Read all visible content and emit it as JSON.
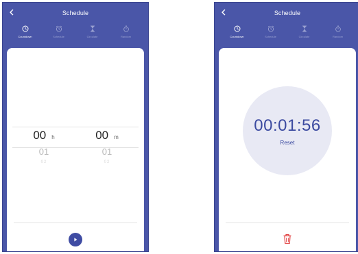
{
  "screens": [
    {
      "header": {
        "title": "Schedule"
      },
      "tabs": [
        {
          "label": "Countdown",
          "icon": "clock-icon",
          "active": true
        },
        {
          "label": "Schedule",
          "icon": "alarm-icon",
          "active": false
        },
        {
          "label": "Circulate",
          "icon": "hourglass-icon",
          "active": false
        },
        {
          "label": "Random",
          "icon": "stopwatch-icon",
          "active": false
        }
      ],
      "picker": {
        "hours": {
          "selected": "00",
          "unit": "h",
          "next": "01",
          "next2": "02"
        },
        "minutes": {
          "selected": "00",
          "unit": "m",
          "next": "01",
          "next2": "02"
        }
      }
    },
    {
      "header": {
        "title": "Schedule"
      },
      "tabs": [
        {
          "label": "Countdown",
          "icon": "clock-icon",
          "active": true
        },
        {
          "label": "Schedule",
          "icon": "alarm-icon",
          "active": false
        },
        {
          "label": "Circulate",
          "icon": "hourglass-icon",
          "active": false
        },
        {
          "label": "Random",
          "icon": "stopwatch-icon",
          "active": false
        }
      ],
      "timer": {
        "display": "00:01:56",
        "reset_label": "Reset"
      }
    }
  ],
  "colors": {
    "header_bg": "#4a56a8",
    "accent": "#3b4aa0",
    "dial_bg": "#e8e9f4",
    "delete": "#e34a4a"
  }
}
